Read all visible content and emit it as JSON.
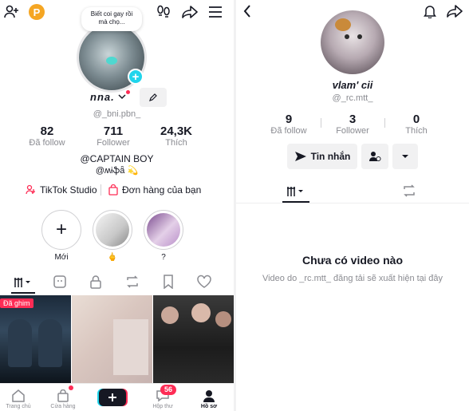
{
  "left": {
    "bubble_text": "Biết coi gay rồi mà chọ...",
    "display_name": "nna.",
    "username": "@_bni.pbn_",
    "stats": [
      {
        "value": "82",
        "label": "Đã follow"
      },
      {
        "value": "711",
        "label": "Follower"
      },
      {
        "value": "24,3K",
        "label": "Thích"
      }
    ],
    "bio_line1": "@CAPTAIN BOY",
    "bio_line2": "@ʍɨֆǟ 💫",
    "links": {
      "studio": "TikTok Studio",
      "orders": "Đơn hàng của bạn"
    },
    "stories": [
      {
        "label": "Mới"
      },
      {
        "label": "🖕"
      },
      {
        "label": "?"
      }
    ],
    "pinned_badge": "Đã ghim",
    "nav": [
      {
        "label": "Trang chủ"
      },
      {
        "label": "Cửa hàng"
      },
      {
        "label": ""
      },
      {
        "label": "Hộp thư",
        "badge": "56"
      },
      {
        "label": "Hồ sơ"
      }
    ]
  },
  "right": {
    "display_name": "vlam' cii",
    "username": "@_rc.mtt_",
    "stats": [
      {
        "value": "9",
        "label": "Đã follow"
      },
      {
        "value": "3",
        "label": "Follower"
      },
      {
        "value": "0",
        "label": "Thích"
      }
    ],
    "message_button": "Tin nhắn",
    "empty_title": "Chưa có video nào",
    "empty_subtitle": "Video do _rc.mtt_ đăng tải sẽ xuất hiện tại đây"
  },
  "colors": {
    "accent": "#fe2c55",
    "muted": "#8a8b91",
    "badge_blue": "#20d5ec",
    "coin": "#f5a623"
  }
}
